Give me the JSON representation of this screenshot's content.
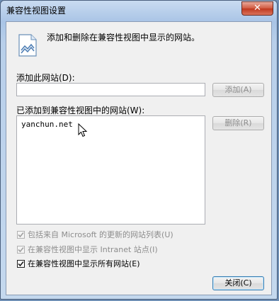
{
  "window": {
    "title": "兼容性视图设置",
    "close_label": "✕"
  },
  "intro": {
    "text": "添加和删除在兼容性视图中显示的网站。",
    "icon": "page-icon"
  },
  "add_section": {
    "label": "添加此网站(D):",
    "input_value": "",
    "add_button": "添加(A)"
  },
  "list_section": {
    "label": "已添加到兼容性视图中的网站(W):",
    "sites": [
      "yanchun.net"
    ],
    "remove_button": "删除(R)"
  },
  "options": {
    "include_ms_list": {
      "label": "包括来自 Microsoft 的更新的网站列表(U)",
      "checked": true,
      "enabled": false
    },
    "show_intranet": {
      "label": "在兼容性视图中显示 Intranet 站点(I)",
      "checked": true,
      "enabled": false
    },
    "show_all": {
      "label": "在兼容性视图中显示所有网站(E)",
      "checked": true,
      "enabled": true
    }
  },
  "footer": {
    "close_button": "关闭(C)"
  }
}
